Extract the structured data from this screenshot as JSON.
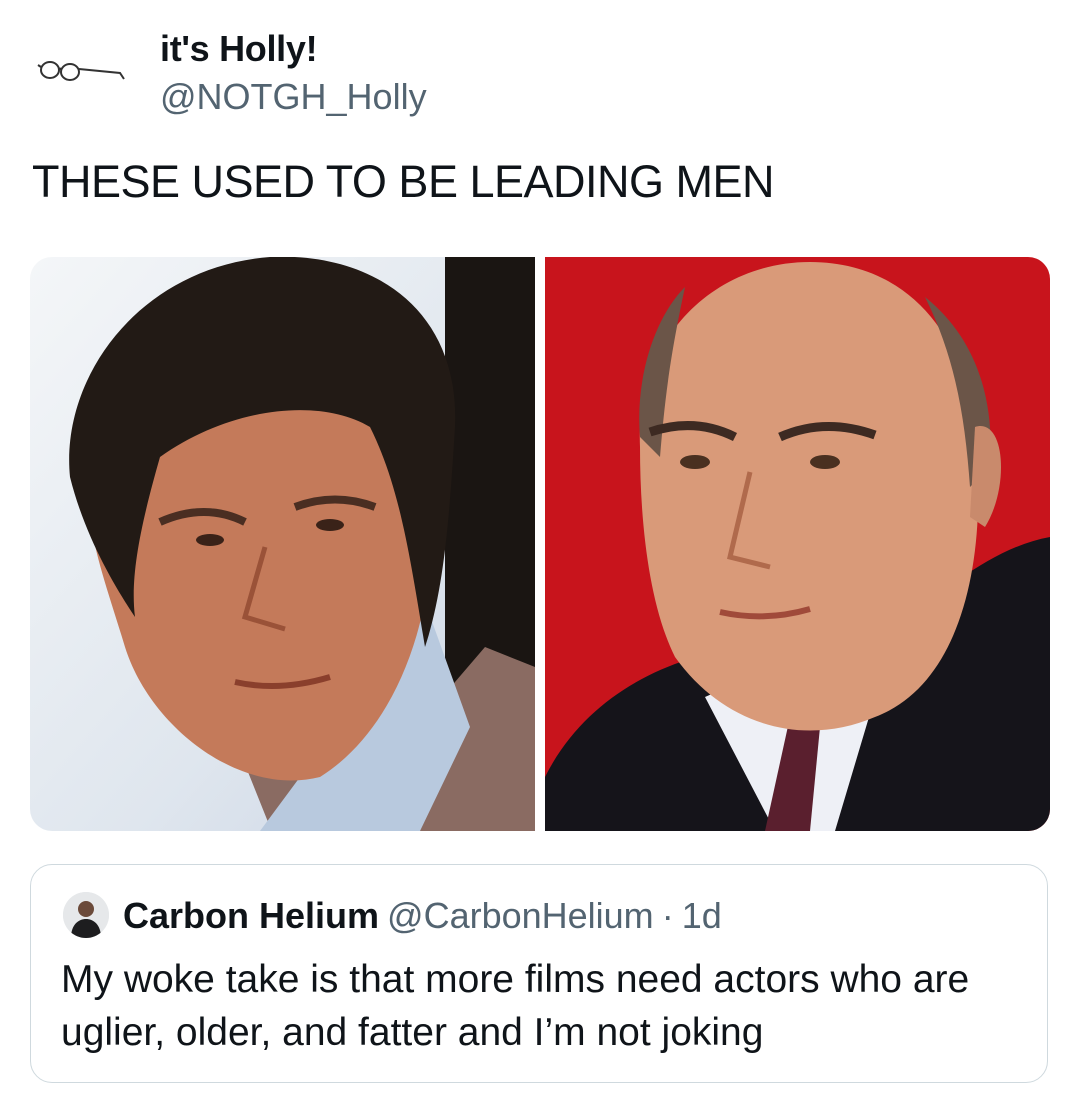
{
  "tweet": {
    "author": {
      "display_name": "it's Holly!",
      "handle": "@NOTGH_Holly",
      "avatar_icon": "glasses-icon"
    },
    "text": "THESE USED TO BE LEADING MEN",
    "media": [
      {
        "kind": "photo",
        "subject": "man-in-plaid-jacket-portrait"
      },
      {
        "kind": "photo",
        "subject": "bald-man-in-suit-red-background"
      }
    ]
  },
  "quote": {
    "author": {
      "display_name": "Carbon Helium",
      "handle": "@CarbonHelium",
      "avatar_icon": "user-photo-avatar"
    },
    "separator": "·",
    "age": "1d",
    "text": "My woke take is that more films need actors who are uglier, older, and fatter and I’m not joking"
  },
  "colors": {
    "text": "#0f1419",
    "secondary": "#536471",
    "border": "#cfd9de",
    "photo_red": "#c8141c"
  }
}
